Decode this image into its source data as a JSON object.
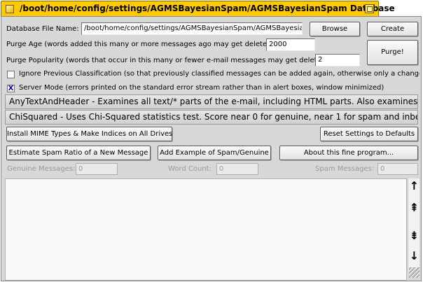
{
  "window": {
    "title": "/boot/home/config/settings/AGMSBayesianSpam/AGMSBayesianSpam Database"
  },
  "database_file": {
    "label": "Database File Name:",
    "value": "/boot/home/config/settings/AGMSBayesianSpam/AGMSBayesianS",
    "browse_label": "Browse",
    "create_label": "Create"
  },
  "purge_age": {
    "label": "Purge Age (words added this many or more messages ago may get deleted):",
    "value": "2000"
  },
  "purge_popularity": {
    "label": "Purge Popularity (words that occur in this many or fewer e-mail messages may get deleted):",
    "value": "2"
  },
  "purge_button_label": "Purge!",
  "ignore_previous": {
    "label": "Ignore Previous Classification (so that previously classified messages can be added again, otherwise only a change in classification is done)",
    "checked": false
  },
  "server_mode": {
    "label": "Server Mode (errors printed on the standard error stream rather than in alert boxes, window minimized)",
    "checked": true,
    "check_glyph": "X"
  },
  "tokenize_mode": {
    "selected": "AnyTextAndHeader - Examines all text/* parts of the e-mail, including HTML parts.  Also examines the header."
  },
  "scoring_mode": {
    "selected": "ChiSquared - Uses Chi-Squared statistics test.  Score near 0 for genuine, near 1 for spam and inbetween if it is uncertain."
  },
  "buttons": {
    "install_mime": "Install MIME Types & Make Indices on All Drives",
    "reset_settings": "Reset Settings to Defaults",
    "estimate_spam": "Estimate Spam Ratio of a New Message",
    "add_example": "Add Example of Spam/Genuine",
    "about": "About this fine program..."
  },
  "counts": {
    "genuine_label": "Genuine Messages:",
    "genuine_value": "0",
    "word_label": "Word Count:",
    "word_value": "0",
    "spam_label": "Spam Messages:",
    "spam_value": "0"
  },
  "scroll_arrows": {
    "top": "↑",
    "up": "⇞",
    "down": "⇟",
    "bottom": "↓"
  },
  "colors": {
    "title_tab": "#ffcb00",
    "panel": "#d8d8d8",
    "check_mark": "#0000c8"
  }
}
